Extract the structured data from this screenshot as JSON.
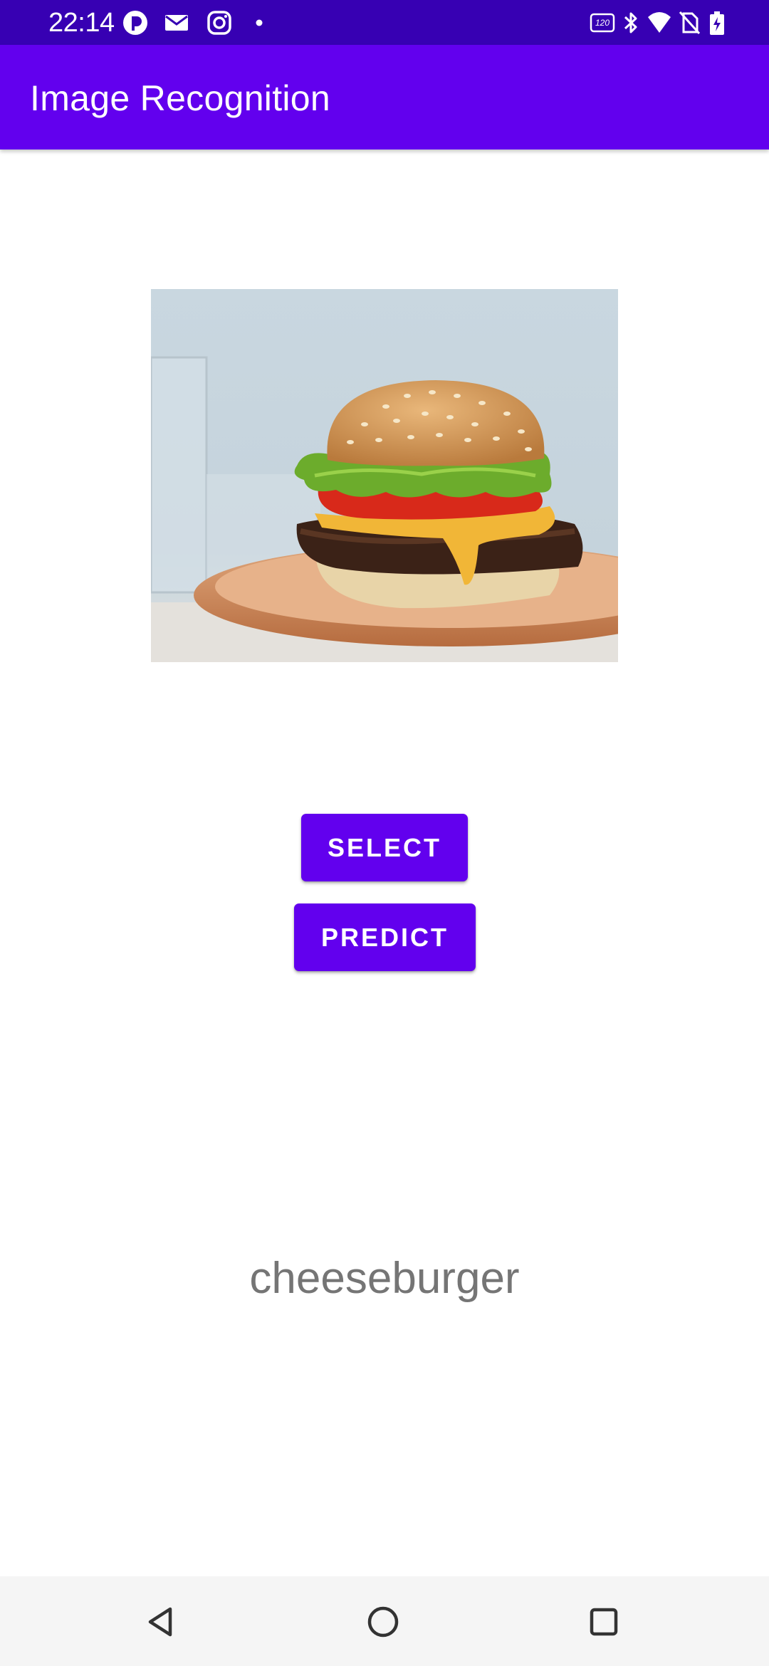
{
  "status_bar": {
    "time": "22:14",
    "left_icons": [
      "app-icon",
      "mail-icon",
      "instagram-icon",
      "dot-icon"
    ],
    "right_icons": [
      "refresh-rate-120hz-icon",
      "bluetooth-icon",
      "wifi-icon",
      "no-sim-icon",
      "battery-charging-icon"
    ]
  },
  "app_bar": {
    "title": "Image Recognition",
    "color": "#6200ee"
  },
  "image": {
    "subject": "cheeseburger-photo"
  },
  "buttons": {
    "select_label": "SELECT",
    "predict_label": "PREDICT"
  },
  "result": {
    "text": "cheeseburger"
  },
  "nav_bar": {
    "icons": [
      "back-icon",
      "home-icon",
      "recents-icon"
    ]
  },
  "colors": {
    "primary": "#6200ee",
    "primary_dark": "#3700b3",
    "result_text": "#757575"
  }
}
